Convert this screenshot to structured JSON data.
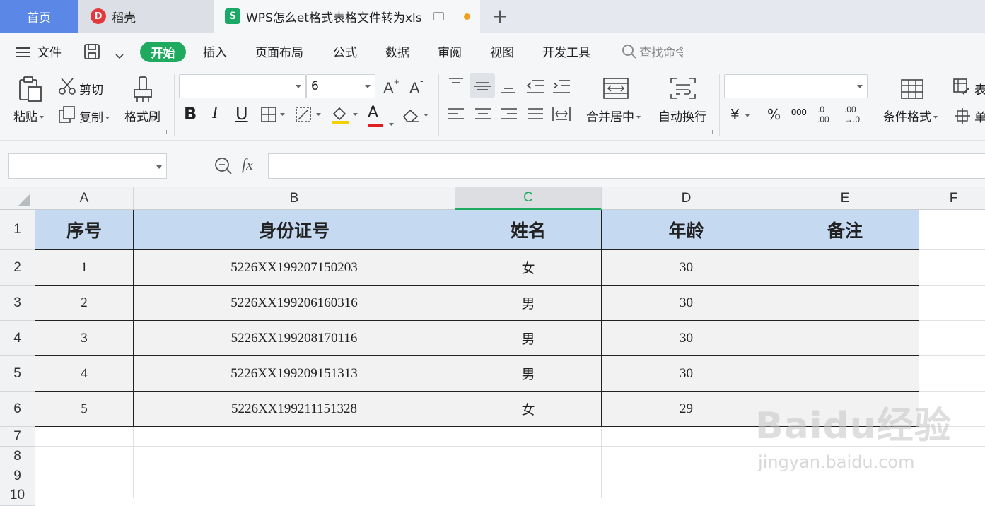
{
  "titlebar": {
    "home_tab": "首页",
    "daoke_tab": "稻壳",
    "daoke_logo": "D",
    "doc_logo": "S",
    "doc_tab": "WPS怎么et格式表格文件转为xls",
    "add_tab": "+"
  },
  "menubar": {
    "file": "文件",
    "items": [
      "开始",
      "插入",
      "页面布局",
      "公式",
      "数据",
      "审阅",
      "视图",
      "开发工具"
    ],
    "search_placeholder": "查找命令"
  },
  "ribbon": {
    "paste": "粘贴",
    "cut": "剪切",
    "copy": "复制",
    "format_painter": "格式刷",
    "font_size": "6",
    "merge_center": "合并居中",
    "wrap_text": "自动换行",
    "conditional_format": "条件格式",
    "table_style": "表",
    "cell": "单",
    "currency_symbol": "¥",
    "percent_symbol": "%",
    "thousands_symbol": "000",
    "increase_decimal": ".0",
    "increase_decimal_sub": ".00",
    "decrease_decimal": ".00",
    "decrease_decimal_sub": "→.0",
    "bold": "B",
    "italic": "I",
    "underline": "U",
    "font_color": "A"
  },
  "formula": {
    "fx": "fx",
    "content": ""
  },
  "sheet": {
    "columns": [
      "A",
      "B",
      "C",
      "D",
      "E",
      "F"
    ],
    "rows": [
      "1",
      "2",
      "3",
      "4",
      "5",
      "6",
      "7",
      "8",
      "9",
      "10"
    ],
    "headers": [
      "序号",
      "身份证号",
      "姓名",
      "年龄",
      "备注"
    ],
    "data": [
      [
        "1",
        "5226XX199207150203",
        "女",
        "30",
        ""
      ],
      [
        "2",
        "5226XX199206160316",
        "男",
        "30",
        ""
      ],
      [
        "3",
        "5226XX199208170116",
        "男",
        "30",
        ""
      ],
      [
        "4",
        "5226XX199209151313",
        "男",
        "30",
        ""
      ],
      [
        "5",
        "5226XX199211151328",
        "女",
        "29",
        ""
      ]
    ]
  },
  "watermark": {
    "text": "Baidu经验",
    "url": "jingyan.baidu.com"
  }
}
